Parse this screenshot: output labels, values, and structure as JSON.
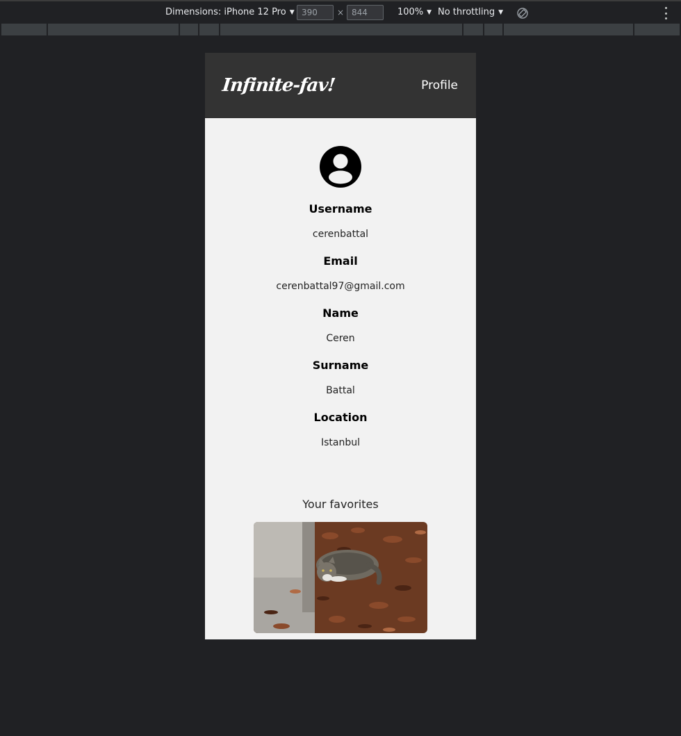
{
  "devtools": {
    "dimensions_label": "Dimensions: iPhone 12 Pro",
    "width_value": "390",
    "height_value": "844",
    "times_symbol": "×",
    "zoom_label": "100%",
    "throttling_label": "No throttling",
    "caret": "▼"
  },
  "app": {
    "logo": "Infinite-fav!",
    "nav_profile": "Profile"
  },
  "profile": {
    "fields": [
      {
        "label": "Username",
        "value": "cerenbattal"
      },
      {
        "label": "Email",
        "value": "cerenbattal97@gmail.com"
      },
      {
        "label": "Name",
        "value": "Ceren"
      },
      {
        "label": "Surname",
        "value": "Battal"
      },
      {
        "label": "Location",
        "value": "Istanbul"
      }
    ]
  },
  "favorites": {
    "title": "Your favorites"
  },
  "colors": {
    "page_bg": "#202124",
    "header_bg": "#333333",
    "content_bg": "#f2f2f2"
  }
}
